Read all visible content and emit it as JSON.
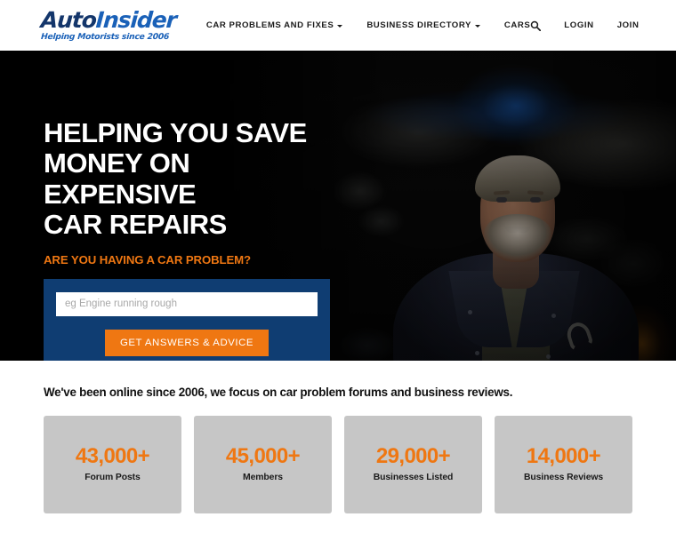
{
  "header": {
    "brand": {
      "part1": "Auto",
      "part2": "Insider",
      "tagline": "Helping Motorists since 2006"
    },
    "nav": [
      {
        "label": "CAR PROBLEMS AND FIXES",
        "has_dropdown": true
      },
      {
        "label": "BUSINESS DIRECTORY",
        "has_dropdown": true
      },
      {
        "label": "CARS",
        "has_dropdown": false
      }
    ],
    "search_icon": "search-icon",
    "login_label": "LOGIN",
    "join_label": "JOIN"
  },
  "hero": {
    "title_line1": "HELPING YOU SAVE",
    "title_line2": "MONEY ON EXPENSIVE",
    "title_line3": "CAR REPAIRS",
    "subtitle": "ARE YOU HAVING A CAR PROBLEM?",
    "search": {
      "placeholder": "eg Engine running rough",
      "value": "",
      "button_label": "GET ANSWERS & ADVICE"
    }
  },
  "stats": {
    "heading": "We've been online since 2006, we focus on car problem forums and business reviews.",
    "cards": [
      {
        "value": "43,000+",
        "label": "Forum Posts"
      },
      {
        "value": "45,000+",
        "label": "Members"
      },
      {
        "value": "29,000+",
        "label": "Businesses Listed"
      },
      {
        "value": "14,000+",
        "label": "Business Reviews"
      }
    ]
  },
  "colors": {
    "brand_dark_blue": "#14366b",
    "brand_blue": "#1a61b8",
    "accent_orange": "#ef7712",
    "panel_blue": "#0f3d72",
    "card_gray": "#c6c6c6"
  }
}
